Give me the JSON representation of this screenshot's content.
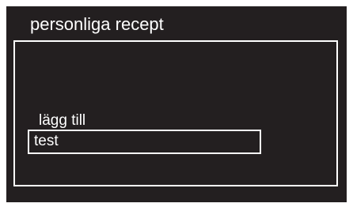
{
  "screen": {
    "title": "personliga recept"
  },
  "menu": {
    "items": [
      {
        "label": "lägg till",
        "selected": false
      },
      {
        "label": "test",
        "selected": true
      }
    ]
  },
  "colors": {
    "background": "#231f20",
    "text": "#ffffff",
    "border": "#ffffff"
  }
}
